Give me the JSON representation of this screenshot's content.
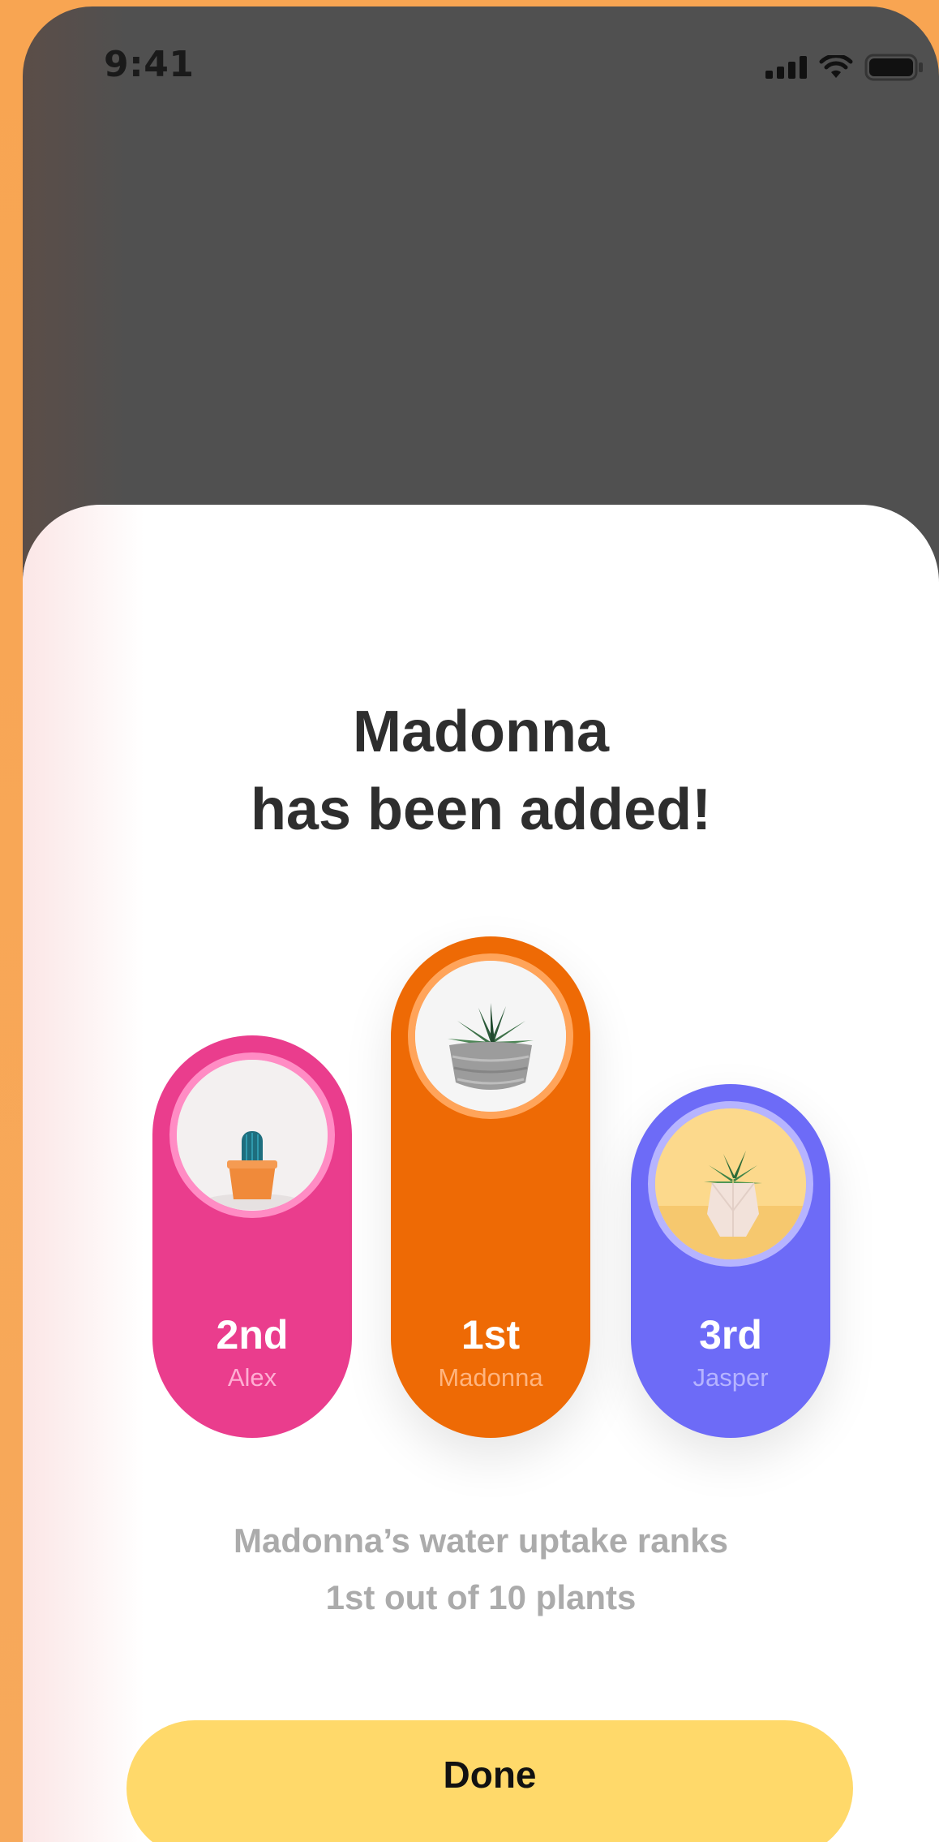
{
  "status_bar": {
    "time": "9:41"
  },
  "sheet": {
    "title_line1": "Madonna",
    "title_line2": "has been added!"
  },
  "ranking": [
    {
      "rank": "2nd",
      "name": "Alex",
      "color": "#EA3D8D",
      "ring": "#FF8CC4",
      "name_color": "#FFAED3",
      "plant": "cactus-photo"
    },
    {
      "rank": "1st",
      "name": "Madonna",
      "color": "#EE6A05",
      "ring": "#FFA45A",
      "name_color": "#FFB47E",
      "plant": "succulent-gray-pot-photo"
    },
    {
      "rank": "3rd",
      "name": "Jasper",
      "color": "#6D6BF7",
      "ring": "#B6B4FF",
      "name_color": "#B6B4FF",
      "plant": "succulent-geometric-pot-photo"
    }
  ],
  "caption": {
    "line1": "Madonna’s water uptake ranks",
    "line2": "1st out of 10 plants"
  },
  "actions": {
    "done_label": "Done"
  },
  "colors": {
    "backdrop": "#F7A85A",
    "overlay": "#505050",
    "sheet": "#FFFFFF",
    "done_button": "#FFD96A"
  }
}
